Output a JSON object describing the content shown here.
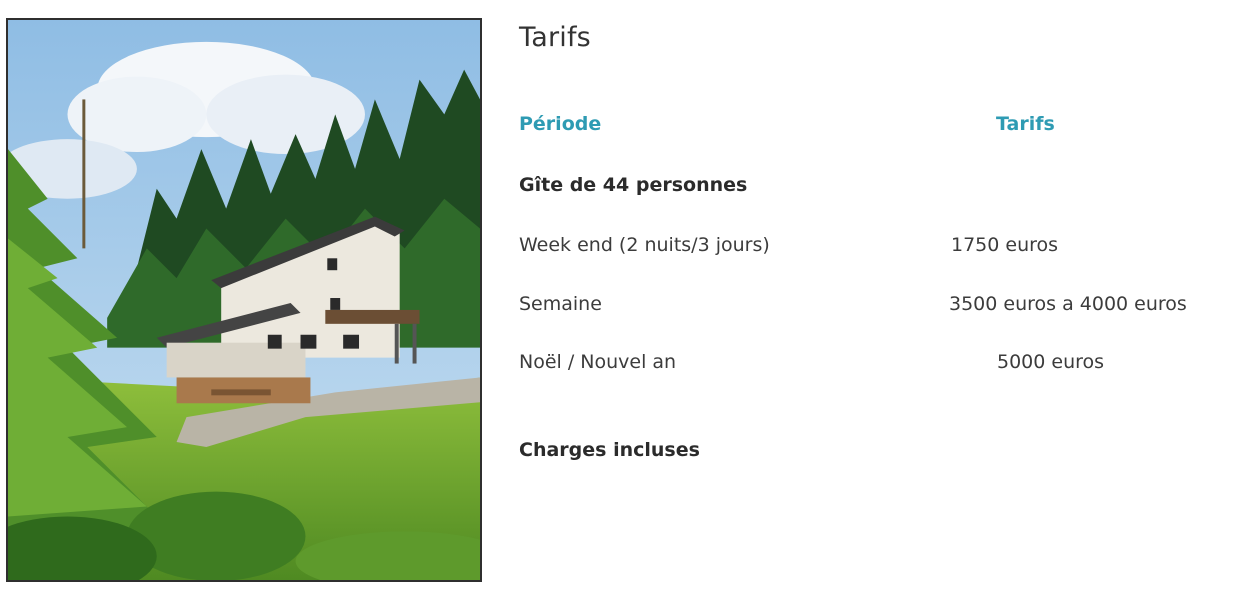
{
  "pricing": {
    "title": "Tarifs",
    "column_period": "Période",
    "column_rates": "Tarifs",
    "section_label": "Gîte de 44 personnes",
    "rows": [
      {
        "period": "Week end (2 nuits/3 jours)",
        "price": "1750 euros"
      },
      {
        "period": "Semaine",
        "price": "3500 euros a 4000 euros"
      },
      {
        "period": "Noël / Nouvel an",
        "price": "5000 euros"
      }
    ],
    "footer_note": "Charges incluses"
  },
  "colors": {
    "accent": "#2e9bb3",
    "text": "#3c3c3c",
    "frame": "#2f2f2f"
  }
}
